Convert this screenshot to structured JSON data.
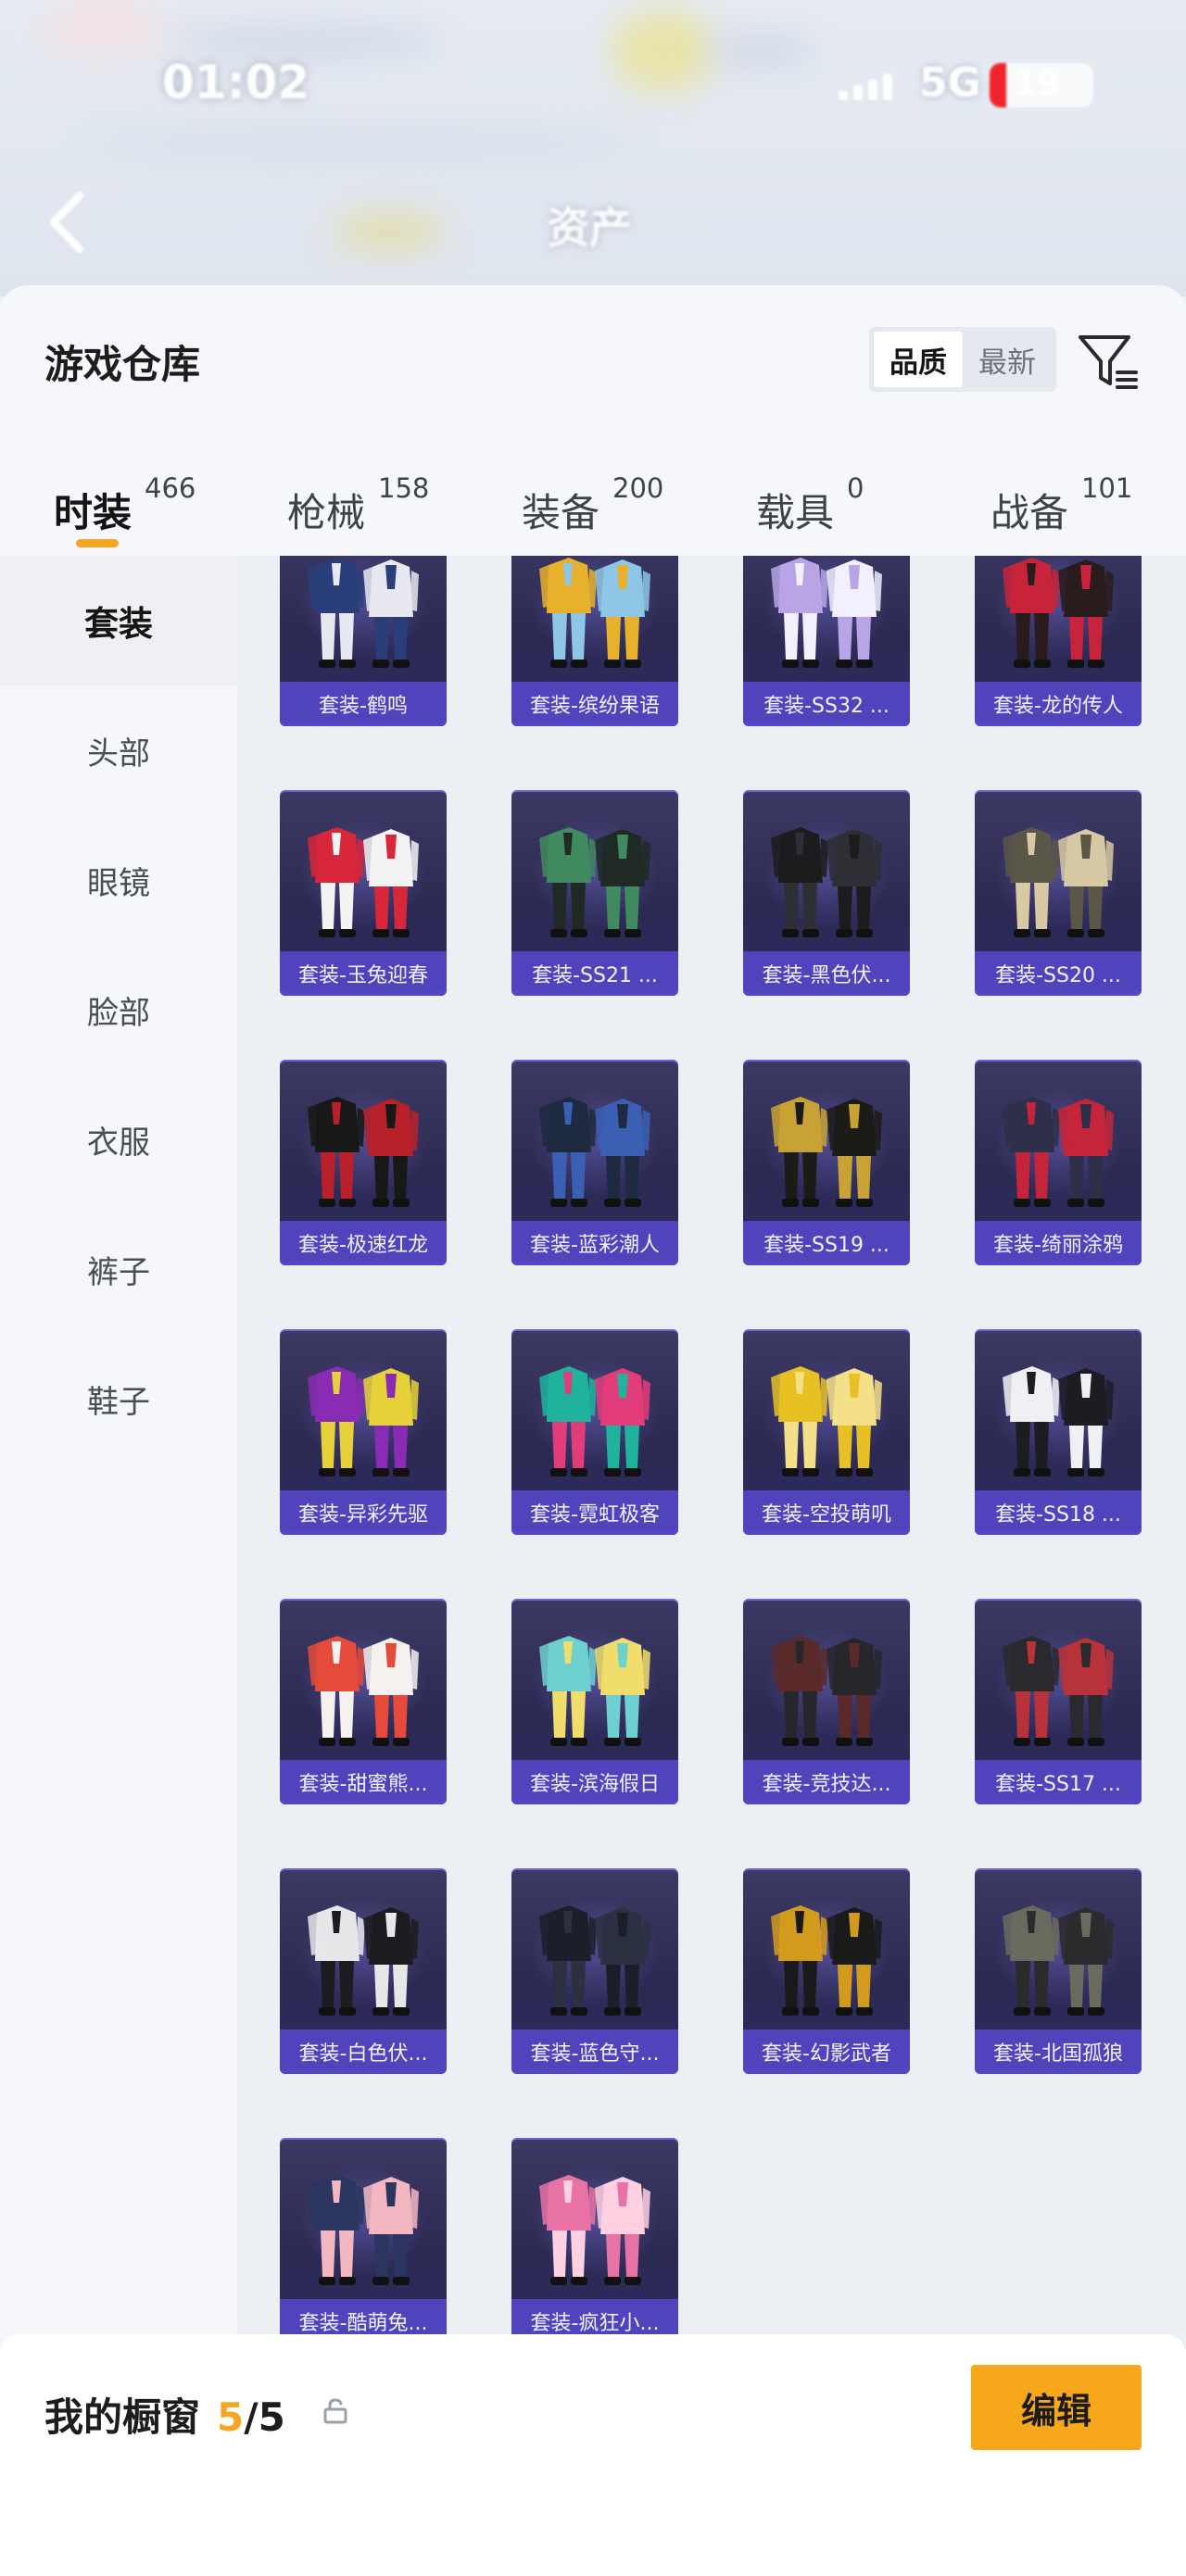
{
  "status_bar": {
    "time": "01:02",
    "network": "5G",
    "battery": "19"
  },
  "nav": {
    "title": "资产"
  },
  "warehouse": {
    "title": "游戏仓库",
    "sort_options": [
      "品质",
      "最新"
    ],
    "selected_sort": "品质"
  },
  "tabs": [
    {
      "label": "时装",
      "count": "466",
      "active": true
    },
    {
      "label": "枪械",
      "count": "158",
      "active": false
    },
    {
      "label": "装备",
      "count": "200",
      "active": false
    },
    {
      "label": "载具",
      "count": "0",
      "active": false
    },
    {
      "label": "战备",
      "count": "101",
      "active": false
    }
  ],
  "categories": [
    {
      "label": "套装",
      "active": true
    },
    {
      "label": "头部",
      "active": false
    },
    {
      "label": "眼镜",
      "active": false
    },
    {
      "label": "脸部",
      "active": false
    },
    {
      "label": "衣服",
      "active": false
    },
    {
      "label": "裤子",
      "active": false
    },
    {
      "label": "鞋子",
      "active": false
    }
  ],
  "items": [
    {
      "name": "套装-鹤鸣",
      "palette": [
        "#2a3f7a",
        "#e8e8f0"
      ]
    },
    {
      "name": "套装-缤纷果语",
      "palette": [
        "#e7b12c",
        "#8ec7e6"
      ]
    },
    {
      "name": "套装-SS32 ...",
      "palette": [
        "#b9a4e6",
        "#f2f0ff"
      ]
    },
    {
      "name": "套装-龙的传人",
      "palette": [
        "#c7233a",
        "#2a1c1c"
      ]
    },
    {
      "name": "套装-玉兔迎春",
      "palette": [
        "#d8263a",
        "#f3f3f3"
      ]
    },
    {
      "name": "套装-SS21 ...",
      "palette": [
        "#3f8a5e",
        "#1f2a24"
      ]
    },
    {
      "name": "套装-黑色伏...",
      "palette": [
        "#1c1c1f",
        "#2e2e35"
      ]
    },
    {
      "name": "套装-SS20 ...",
      "palette": [
        "#5a5648",
        "#d7c9a3"
      ]
    },
    {
      "name": "套装-极速红龙",
      "palette": [
        "#181818",
        "#b8212a"
      ]
    },
    {
      "name": "套装-蓝彩潮人",
      "palette": [
        "#1e2a40",
        "#3b5fb3"
      ]
    },
    {
      "name": "套装-SS19 ...",
      "palette": [
        "#c9a235",
        "#1d1b18"
      ]
    },
    {
      "name": "套装-绮丽涂鸦",
      "palette": [
        "#2e2f49",
        "#c4253a"
      ]
    },
    {
      "name": "套装-异彩先驱",
      "palette": [
        "#8a2bb3",
        "#e6d13a"
      ]
    },
    {
      "name": "套装-霓虹极客",
      "palette": [
        "#1fb39b",
        "#e33c7a"
      ]
    },
    {
      "name": "套装-空投萌叽",
      "palette": [
        "#e7c024",
        "#f5e08a"
      ]
    },
    {
      "name": "套装-SS18 ...",
      "palette": [
        "#f0f0f4",
        "#1d1c22"
      ]
    },
    {
      "name": "套装-甜蜜熊...",
      "palette": [
        "#e54a3a",
        "#f6f1ee"
      ]
    },
    {
      "name": "套装-滨海假日",
      "palette": [
        "#6fd0d0",
        "#f1dd6b"
      ]
    },
    {
      "name": "套装-竞技达...",
      "palette": [
        "#5a2a2a",
        "#27262a"
      ]
    },
    {
      "name": "套装-SS17 ...",
      "palette": [
        "#2a2a2e",
        "#b8323a"
      ]
    },
    {
      "name": "套装-白色伏...",
      "palette": [
        "#e7e7ea",
        "#1c1c20"
      ]
    },
    {
      "name": "套装-蓝色守...",
      "palette": [
        "#1c1f29",
        "#2c3142"
      ]
    },
    {
      "name": "套装-幻影武者",
      "palette": [
        "#d39b1d",
        "#1a1a1a"
      ]
    },
    {
      "name": "套装-北国孤狼",
      "palette": [
        "#6b6a5f",
        "#2b2a2c"
      ]
    },
    {
      "name": "套装-酷萌兔...",
      "palette": [
        "#2a3560",
        "#f2b7c1"
      ]
    },
    {
      "name": "套装-疯狂小...",
      "palette": [
        "#e872a4",
        "#ffd0e1"
      ]
    }
  ],
  "showcase": {
    "title": "我的橱窗",
    "current": "5",
    "total": "/5",
    "edit_label": "编辑"
  },
  "colors": {
    "accent": "#f6a81a",
    "card_bg": "#2c2a52",
    "card_label": "#5446c4"
  }
}
